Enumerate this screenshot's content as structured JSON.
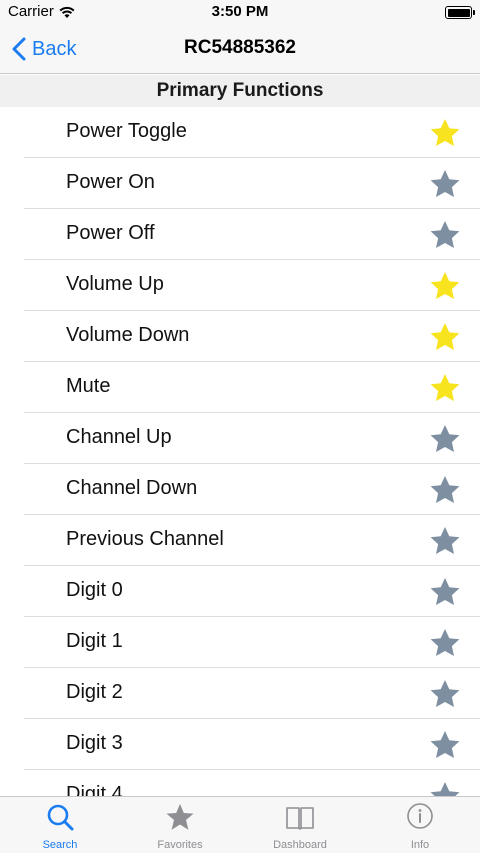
{
  "status_bar": {
    "carrier": "Carrier",
    "time": "3:50 PM"
  },
  "nav": {
    "back_label": "Back",
    "title": "RC54885362"
  },
  "section": {
    "title": "Primary Functions"
  },
  "colors": {
    "accent": "#1a7cf0",
    "star_favorite": "#f7e41e",
    "star_default": "#7d8fa0",
    "tab_inactive": "#8e8e93"
  },
  "functions": [
    {
      "label": "Power Toggle",
      "favorite": true
    },
    {
      "label": "Power On",
      "favorite": false
    },
    {
      "label": "Power Off",
      "favorite": false
    },
    {
      "label": "Volume Up",
      "favorite": true
    },
    {
      "label": "Volume Down",
      "favorite": true
    },
    {
      "label": "Mute",
      "favorite": true
    },
    {
      "label": "Channel Up",
      "favorite": false
    },
    {
      "label": "Channel Down",
      "favorite": false
    },
    {
      "label": "Previous Channel",
      "favorite": false
    },
    {
      "label": "Digit 0",
      "favorite": false
    },
    {
      "label": "Digit 1",
      "favorite": false
    },
    {
      "label": "Digit 2",
      "favorite": false
    },
    {
      "label": "Digit 3",
      "favorite": false
    },
    {
      "label": "Digit 4",
      "favorite": false
    }
  ],
  "tabs": [
    {
      "label": "Search",
      "icon": "search-icon",
      "active": true
    },
    {
      "label": "Favorites",
      "icon": "star-icon",
      "active": false
    },
    {
      "label": "Dashboard",
      "icon": "book-icon",
      "active": false
    },
    {
      "label": "Info",
      "icon": "info-icon",
      "active": false
    }
  ]
}
